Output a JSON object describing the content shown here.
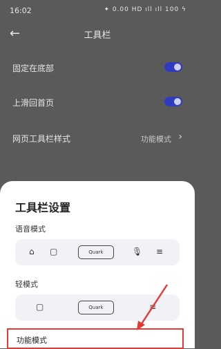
{
  "status": {
    "time": "16:02",
    "icons": "✦ 0.00 HD ıll ıll 100 ϟ"
  },
  "nav": {
    "title": "工具栏"
  },
  "settings": [
    {
      "label": "固定在底部",
      "toggle": true
    },
    {
      "label": "上滑回首页",
      "toggle": true
    },
    {
      "label": "网页工具栏样式",
      "value": "功能模式"
    }
  ],
  "sheet": {
    "title": "工具栏设置",
    "voice_mode": {
      "label": "语音模式",
      "quark": "Quark"
    },
    "light_mode": {
      "label": "轻模式",
      "quark": "Quark"
    },
    "function_mode": {
      "label": "功能模式"
    }
  },
  "colors": {
    "toggle": "#2f3cbf",
    "highlight": "#e53935"
  }
}
